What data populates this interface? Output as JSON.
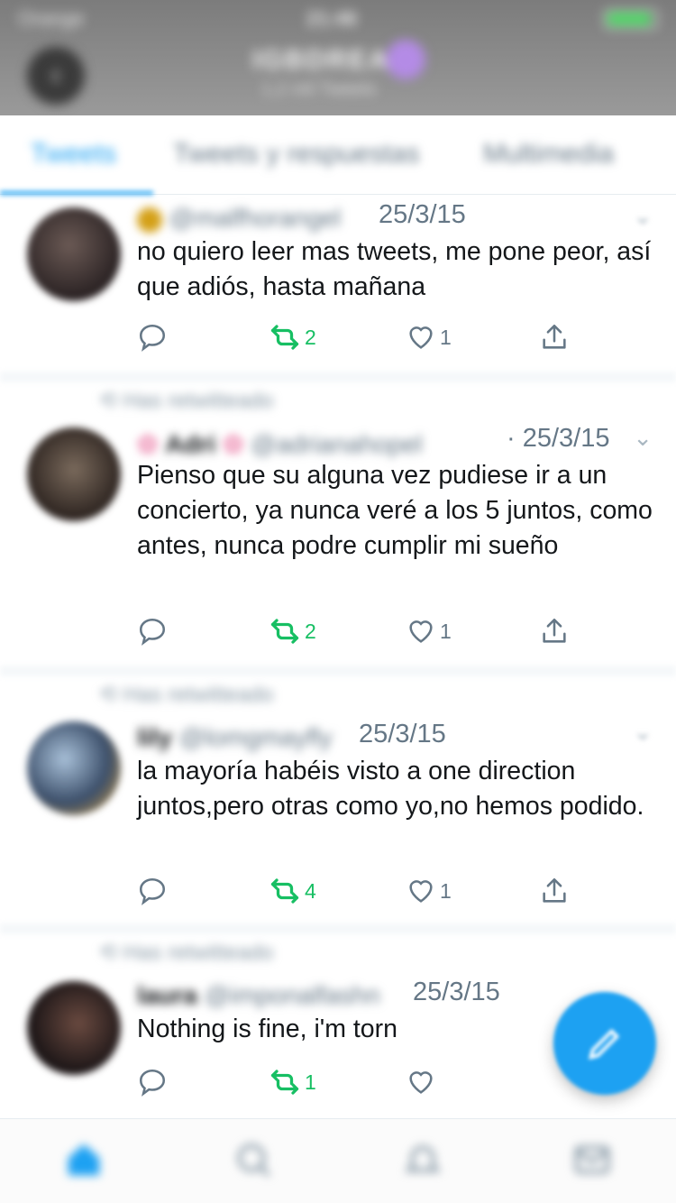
{
  "status_bar": {
    "carrier": "Orange",
    "time": "21:46"
  },
  "header": {
    "name": "IGBDREA",
    "subtitle": "1,2 mil Tweets"
  },
  "tabs": [
    {
      "label": "Tweets",
      "active": true
    },
    {
      "label": "Tweets y respuestas",
      "active": false
    },
    {
      "label": "Multimedia",
      "active": false
    }
  ],
  "tweets": [
    {
      "retweet_context": "",
      "author_name": "",
      "author_handle": "@malfhorangel",
      "date": "25/3/15",
      "text": "no quiero leer mas tweets, me pone peor, así que adiós, hasta mañana",
      "retweets": "2",
      "likes": "1"
    },
    {
      "retweet_context": "Has retwitteado",
      "author_name": "Adri",
      "author_handle": "@adrianahopel",
      "date": "· 25/3/15",
      "text": "Pienso que su alguna vez pudiese ir a un concierto, ya nunca veré a los 5 juntos, como antes, nunca podre cumplir mi sueño",
      "retweets": "2",
      "likes": "1"
    },
    {
      "retweet_context": "Has retwitteado",
      "author_name": "lily",
      "author_handle": "@lomgmayfly",
      "date": "25/3/15",
      "text": "la mayoría habéis visto a one direction juntos,pero otras como yo,no hemos podido.",
      "retweets": "4",
      "likes": "1"
    },
    {
      "retweet_context": "Has retwitteado",
      "author_name": "laura",
      "author_handle": "@imponalfashn",
      "date": "25/3/15",
      "text": "Nothing is fine, i'm torn",
      "retweets": "1",
      "likes": ""
    }
  ],
  "colors": {
    "accent": "#1da1f2",
    "retweet_green": "#17bf63",
    "secondary_text": "#657786"
  },
  "icons": {
    "reply": "reply-icon",
    "retweet": "retweet-icon",
    "like": "heart-icon",
    "share": "share-icon",
    "compose": "compose-icon"
  }
}
